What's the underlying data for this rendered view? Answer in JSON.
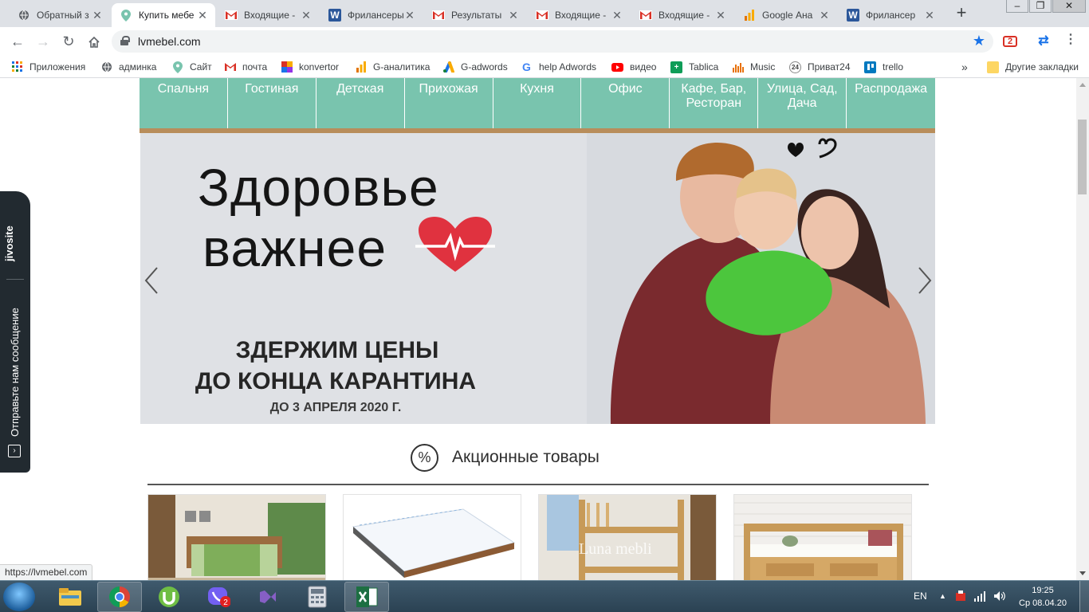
{
  "browser": {
    "tabs": [
      {
        "label": "Обратный з",
        "icon": "globe-icon",
        "active": false
      },
      {
        "label": "Купить мебе",
        "icon": "map-pin-icon",
        "active": true
      },
      {
        "label": "Входящие -",
        "icon": "gmail-icon",
        "active": false
      },
      {
        "label": "Фрилансеры",
        "icon": "word-icon",
        "active": false
      },
      {
        "label": "Результаты",
        "icon": "gmail-icon",
        "active": false
      },
      {
        "label": "Входящие -",
        "icon": "gmail-icon",
        "active": false
      },
      {
        "label": "Входящие -",
        "icon": "gmail-icon",
        "active": false
      },
      {
        "label": "Google Ана",
        "icon": "analytics-icon",
        "active": false
      },
      {
        "label": "Фрилансер",
        "icon": "word-icon",
        "active": false
      }
    ],
    "tab_close_glyph": "✕",
    "new_tab_glyph": "+",
    "url": "lvmebel.com",
    "status_url": "https://lvmebel.com",
    "ext_badge": "2"
  },
  "bookmarks": {
    "items": [
      {
        "label": "Приложения",
        "icon": "apps-grid-icon"
      },
      {
        "label": "админка",
        "icon": "globe-icon"
      },
      {
        "label": "Сайт",
        "icon": "map-pin-icon"
      },
      {
        "label": "почта",
        "icon": "gmail-icon"
      },
      {
        "label": "konvertor",
        "icon": "konvertor-icon"
      },
      {
        "label": "G-аналитика",
        "icon": "analytics-icon"
      },
      {
        "label": "G-adwords",
        "icon": "adwords-icon"
      },
      {
        "label": "help Adwords",
        "icon": "google-icon"
      },
      {
        "label": "видео",
        "icon": "youtube-icon"
      },
      {
        "label": "Tablica",
        "icon": "tablica-icon"
      },
      {
        "label": "Music",
        "icon": "music-icon"
      },
      {
        "label": "Приват24",
        "icon": "privat24-icon"
      },
      {
        "label": "trello",
        "icon": "trello-icon"
      }
    ],
    "overflow_glyph": "»",
    "other_label": "Другие закладки"
  },
  "site": {
    "menu": [
      {
        "label": "Спальня"
      },
      {
        "label": "Гостиная"
      },
      {
        "label": "Детская"
      },
      {
        "label": "Прихожая"
      },
      {
        "label": "Кухня"
      },
      {
        "label": "Офис"
      },
      {
        "label": "Кафе, Бар, Ресторан"
      },
      {
        "label": "Улица, Сад, Дача"
      },
      {
        "label": "Распродажа"
      }
    ],
    "banner": {
      "headline_1": "Здоровье",
      "headline_2": "важнее",
      "promo_1": "ЗДЕРЖИМ ЦЕНЫ",
      "promo_2": "ДО КОНЦА КАРАНТИНА",
      "promo_3": "ДО 3 АПРЕЛЯ 2020 Г."
    },
    "section": {
      "icon_glyph": "%",
      "title": "Акционные товары"
    },
    "products": [
      {
        "icon": "bed-photo"
      },
      {
        "icon": "mattress-photo"
      },
      {
        "icon": "bunk-bed-photo",
        "watermark": "Luna mebli"
      },
      {
        "icon": "kids-bed-photo"
      }
    ]
  },
  "jivosite": {
    "brand": "jivosite",
    "label": "Отправьте нам сообщение"
  },
  "taskbar": {
    "apps": [
      {
        "icon": "explorer-icon"
      },
      {
        "icon": "chrome-icon"
      },
      {
        "icon": "utorrent-icon"
      },
      {
        "icon": "viber-icon",
        "badge": "2"
      },
      {
        "icon": "visual-studio-icon"
      },
      {
        "icon": "calculator-icon"
      },
      {
        "icon": "excel-icon"
      }
    ],
    "lang": "EN",
    "time": "19:25",
    "date": "Ср 08.04.20"
  },
  "colors": {
    "menu_bg": "#79c4ae",
    "menu_underline": "#b88d5b",
    "banner_bg": "#dfe1e5",
    "heart": "#e0323f",
    "jivo_bg": "#222a30",
    "chrome_tabstrip": "#dee1e6",
    "star_blue": "#1a73e8"
  }
}
